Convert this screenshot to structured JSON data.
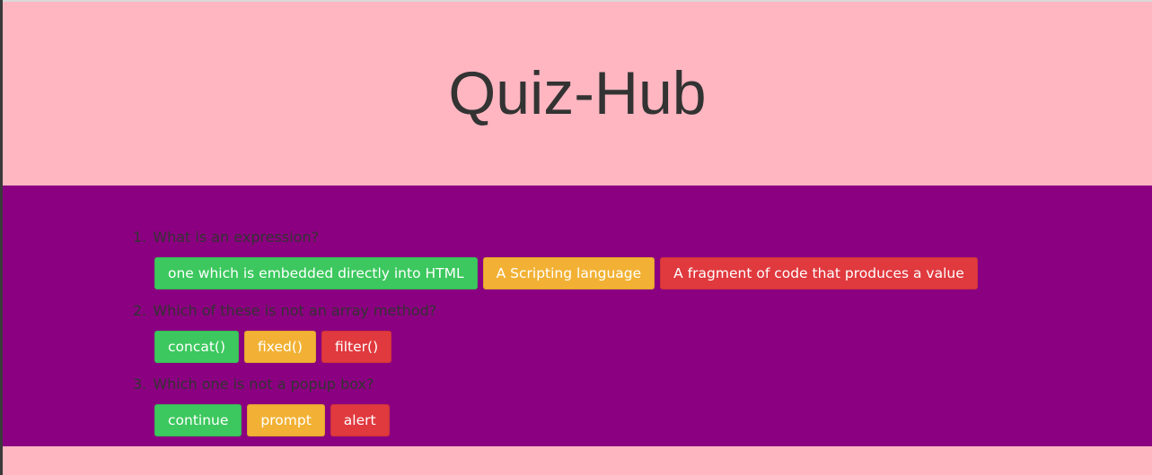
{
  "header": {
    "title": "Quiz-Hub"
  },
  "questions": [
    {
      "number": "1.",
      "text": "What is an expression?",
      "answers": [
        "one which is embedded directly into HTML",
        "A Scripting language",
        "A fragment of code that produces a value"
      ]
    },
    {
      "number": "2.",
      "text": "Which of these is not an array method?",
      "answers": [
        "concat()",
        "fixed()",
        "filter()"
      ]
    },
    {
      "number": "3.",
      "text": "Which one is not a popup box?",
      "answers": [
        "continue",
        "prompt",
        "alert"
      ]
    }
  ],
  "colors": {
    "header_bg": "#ffb6c1",
    "main_bg": "#8b0080",
    "answer_1": "#3cc85e",
    "answer_2": "#f2b134",
    "answer_3": "#e0393e",
    "text": "#333333"
  }
}
